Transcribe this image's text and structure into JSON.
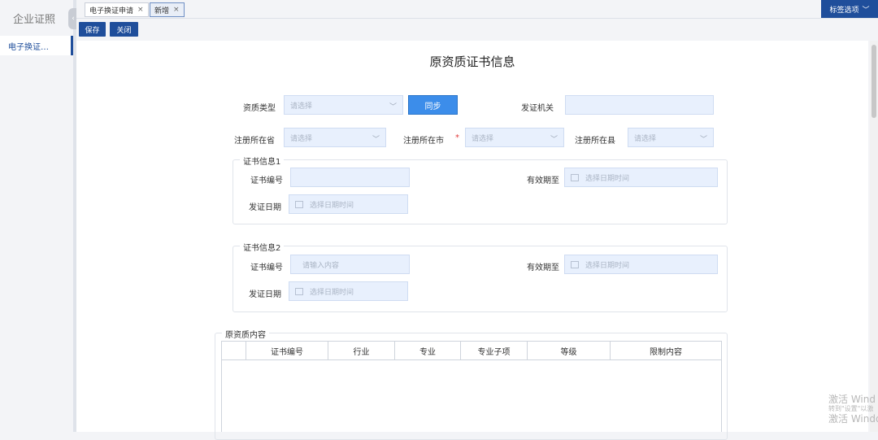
{
  "sidebar": {
    "brand": "企业证照",
    "collapse_icon": "‹",
    "items": [
      {
        "label": "电子换证…"
      }
    ]
  },
  "tabs": [
    {
      "label": "电子换证申请",
      "close": "×"
    },
    {
      "label": "新增",
      "close": "×"
    }
  ],
  "tab_options": {
    "label": "标签选项",
    "chevron": "﹀"
  },
  "toolbar": {
    "save": "保存",
    "close": "关闭"
  },
  "form": {
    "title": "原资质证书信息",
    "qualification_type": {
      "label": "资质类型",
      "placeholder": "请选择"
    },
    "sync_button": "同步",
    "issuing_authority": {
      "label": "发证机关",
      "value": ""
    },
    "reg_province": {
      "label": "注册所在省",
      "placeholder": "请选择"
    },
    "reg_city": {
      "label": "注册所在市",
      "required_mark": "*",
      "placeholder": "请选择"
    },
    "reg_county": {
      "label": "注册所在县",
      "placeholder": "请选择"
    },
    "cert1": {
      "legend": "证书信息1",
      "cert_no": {
        "label": "证书编号",
        "value": ""
      },
      "valid_until": {
        "label": "有效期至",
        "placeholder": "选择日期时间"
      },
      "issue_date": {
        "label": "发证日期",
        "placeholder": "选择日期时间"
      }
    },
    "cert2": {
      "legend": "证书信息2",
      "cert_no": {
        "label": "证书编号",
        "placeholder": "请输入内容"
      },
      "valid_until": {
        "label": "有效期至",
        "placeholder": "选择日期时间"
      },
      "issue_date": {
        "label": "发证日期",
        "placeholder": "选择日期时间"
      }
    },
    "orig_content": {
      "legend": "原资质内容",
      "columns": [
        "",
        "证书编号",
        "行业",
        "专业",
        "专业子项",
        "等级",
        "限制内容"
      ]
    }
  },
  "watermark": {
    "line1": "激活 Wind",
    "line2": "转到\"设置\"以激",
    "line3": "激活 Window"
  },
  "colors": {
    "primary": "#1f4e9b",
    "sync": "#3c8dea",
    "field_bg": "#e8f0fd",
    "required": "#e23b3b"
  }
}
